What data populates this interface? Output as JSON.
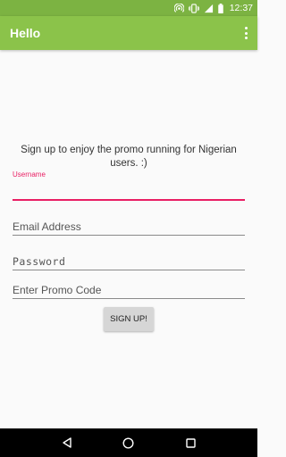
{
  "status_bar": {
    "time": "12:37",
    "icons": [
      "hotspot-icon",
      "vibrate-icon",
      "signal-icon",
      "battery-icon"
    ],
    "color": "#7cb342"
  },
  "app_bar": {
    "title": "Hello",
    "color": "#8bc34a",
    "menu_icon": "overflow-menu-icon"
  },
  "form": {
    "intro": "Sign up to enjoy the promo running for Nigerian users. :)",
    "username": {
      "label": "Username",
      "value": "",
      "placeholder": ""
    },
    "email": {
      "placeholder": "Email Address",
      "value": ""
    },
    "password": {
      "placeholder": "Password",
      "value": ""
    },
    "promo": {
      "placeholder": "Enter Promo Code",
      "value": ""
    },
    "submit_label": "SIGN UP!",
    "accent_color": "#e91e63"
  },
  "nav_bar": {
    "buttons": [
      "back-icon",
      "home-icon",
      "recents-icon"
    ]
  }
}
